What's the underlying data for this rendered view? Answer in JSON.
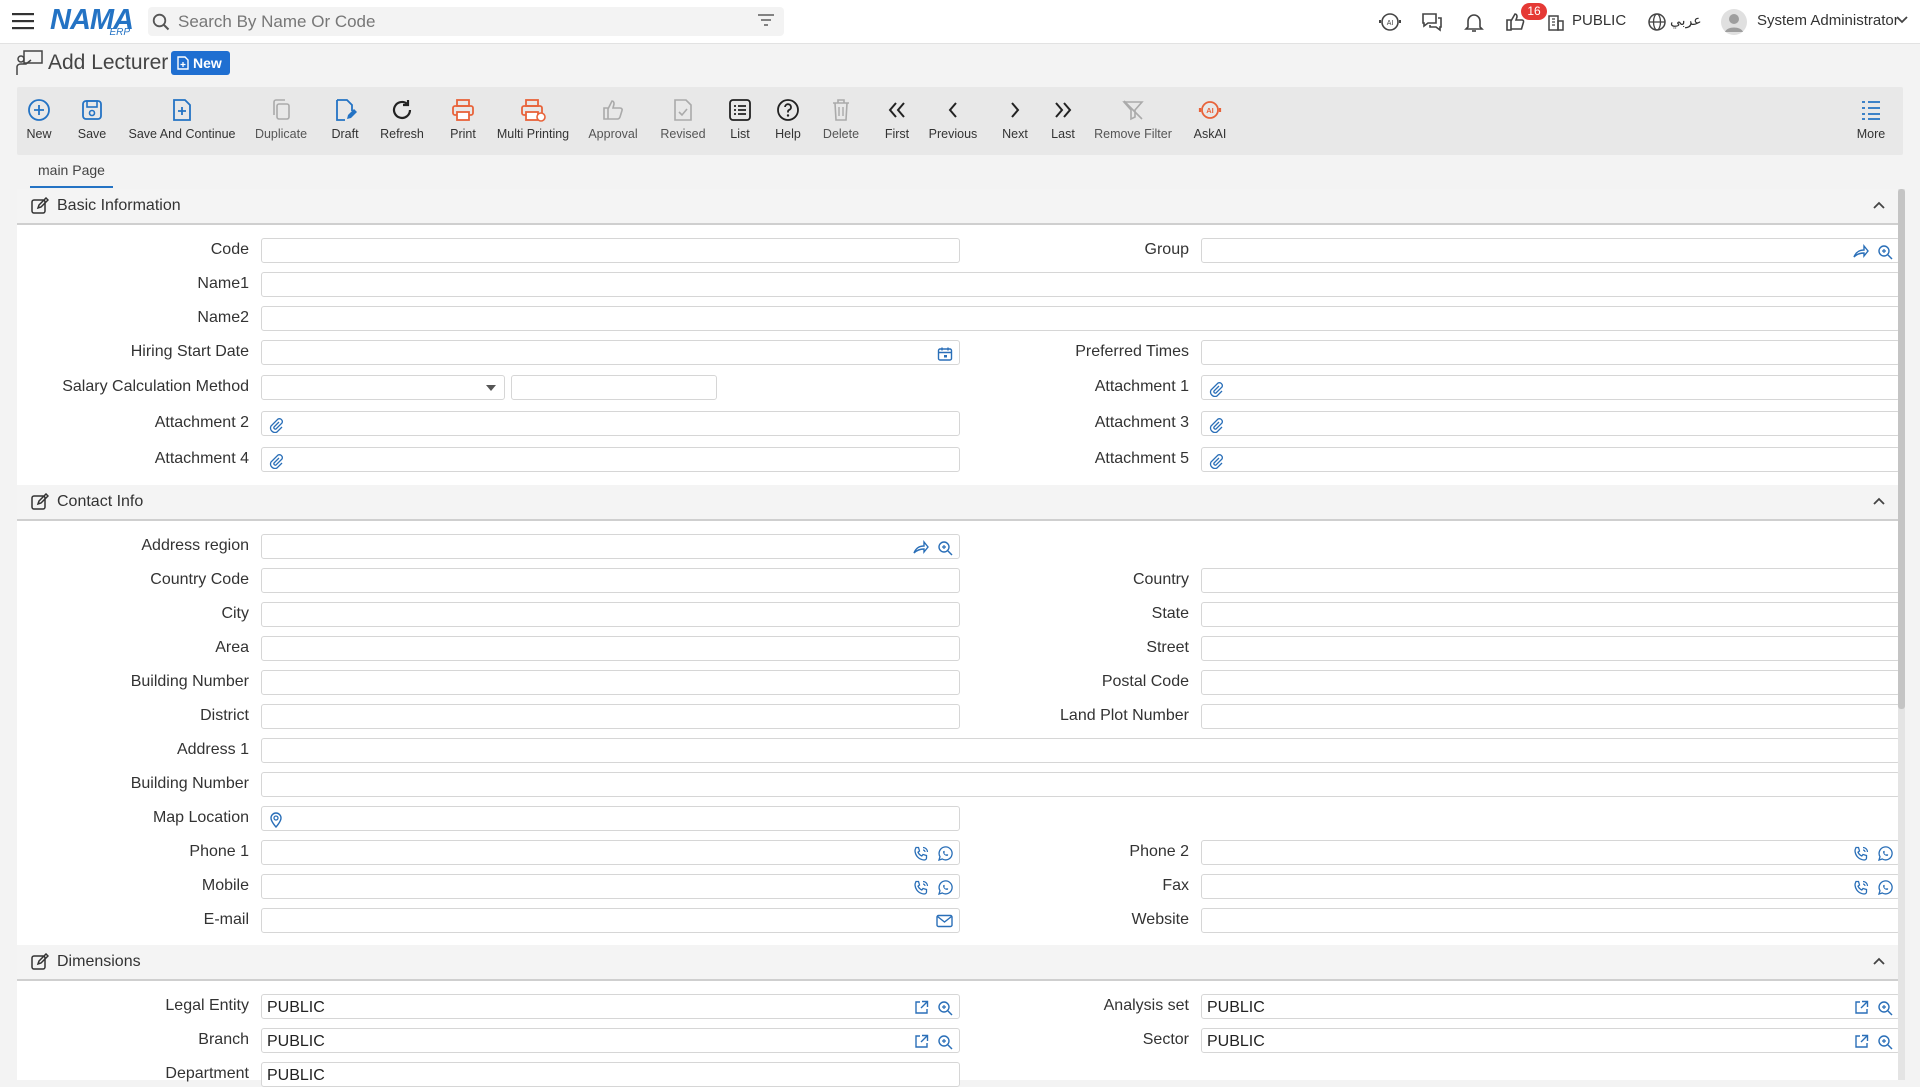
{
  "header": {
    "logo_text": "NAMA",
    "logo_sub": "ERP",
    "search_placeholder": "Search By Name Or Code",
    "notifications_count": "16",
    "company": "PUBLIC",
    "language": "عربي",
    "user_name": "System Administrator"
  },
  "page": {
    "title": "Add Lecturer",
    "status_badge": "New"
  },
  "toolbar": {
    "new": "New",
    "save": "Save",
    "save_continue": "Save And Continue",
    "duplicate": "Duplicate",
    "draft": "Draft",
    "refresh": "Refresh",
    "print": "Print",
    "multi_printing": "Multi Printing",
    "approval": "Approval",
    "revised": "Revised",
    "list": "List",
    "help": "Help",
    "delete": "Delete",
    "first": "First",
    "previous": "Previous",
    "next": "Next",
    "last": "Last",
    "remove_filter": "Remove Filter",
    "askai": "AskAI",
    "more": "More"
  },
  "tabs": {
    "main_page": "main Page"
  },
  "sections": {
    "basic": {
      "title": "Basic Information",
      "code": "Code",
      "group": "Group",
      "name1": "Name1",
      "name2": "Name2",
      "hiring_start_date": "Hiring Start Date",
      "preferred_times": "Preferred Times",
      "salary_calc": "Salary Calculation Method",
      "attachment1": "Attachment 1",
      "attachment2": "Attachment 2",
      "attachment3": "Attachment 3",
      "attachment4": "Attachment 4",
      "attachment5": "Attachment 5"
    },
    "contact": {
      "title": "Contact Info",
      "address_region": "Address region",
      "country_code": "Country Code",
      "country": "Country",
      "city": "City",
      "state": "State",
      "area": "Area",
      "street": "Street",
      "building_number": "Building Number",
      "postal_code": "Postal Code",
      "district": "District",
      "land_plot": "Land Plot Number",
      "address1": "Address 1",
      "building_number2": "Building Number",
      "map_location": "Map Location",
      "phone1": "Phone 1",
      "phone2": "Phone 2",
      "mobile": "Mobile",
      "fax": "Fax",
      "email": "E-mail",
      "website": "Website"
    },
    "dimensions": {
      "title": "Dimensions",
      "legal_entity": "Legal Entity",
      "legal_entity_value": "PUBLIC",
      "analysis_set": "Analysis set",
      "analysis_set_value": "PUBLIC",
      "branch": "Branch",
      "branch_value": "PUBLIC",
      "sector": "Sector",
      "sector_value": "PUBLIC",
      "department": "Department",
      "department_value": "PUBLIC"
    }
  },
  "colors": {
    "accent": "#2473c4",
    "orange": "#e8633a",
    "badge_red": "#e53935"
  }
}
